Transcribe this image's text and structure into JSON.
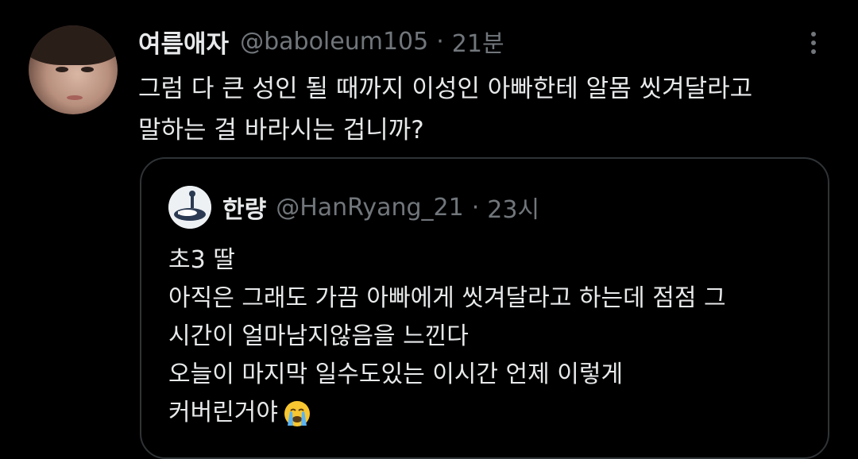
{
  "tweet": {
    "author_name": "여름애자",
    "author_handle": "@baboleum105",
    "separator": "·",
    "time": "21분",
    "text_lines": [
      "그럼 다 큰 성인 될 때까지 이성인 아빠한테 알몸 씻겨달라고",
      "말하는 걸 바라시는 겁니까?"
    ]
  },
  "quote": {
    "author_name": "한량",
    "author_handle": "@HanRyang_21",
    "separator": "·",
    "time": "23시",
    "text_lines": [
      "초3 딸",
      "아직은 그래도 가끔 아빠에게 씻겨달라고 하는데 점점 그",
      "시간이 얼마남지않음을 느낀다",
      "오늘이 마지막 일수도있는 이시간 언제 이렇게",
      "커버린거야"
    ],
    "trailing_emoji": "crying-face-emoji"
  },
  "icons": {
    "more": "more-vertical-icon"
  },
  "colors": {
    "background": "#000000",
    "primary_text": "#e7e9ea",
    "secondary_text": "#71767b",
    "quote_border": "#2f3336"
  }
}
